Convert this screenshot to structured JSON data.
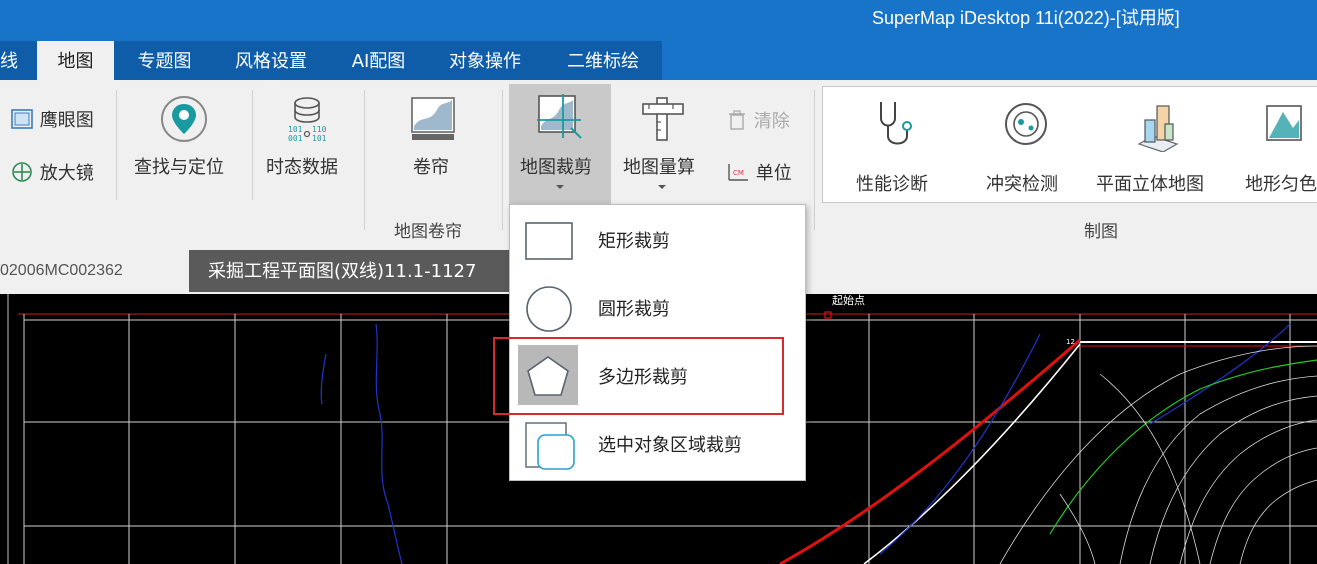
{
  "window": {
    "title": "SuperMap iDesktop 11i(2022)-[试用版]"
  },
  "tabs": [
    {
      "label": "线",
      "active": false
    },
    {
      "label": "地图",
      "active": true
    },
    {
      "label": "专题图",
      "active": false
    },
    {
      "label": "风格设置",
      "active": false
    },
    {
      "label": "AI配图",
      "active": false
    },
    {
      "label": "对象操作",
      "active": false
    },
    {
      "label": "二维标绘",
      "active": false
    }
  ],
  "ribbon": {
    "eagle_eye": "鹰眼图",
    "magnifier": "放大镜",
    "find_locate": "查找与定位",
    "temporal_data": "时态数据",
    "swipe": "卷帘",
    "map_swipe_group": "地图卷帘",
    "map_clip": "地图裁剪",
    "map_measure": "地图量算",
    "clear": "清除",
    "unit": "单位",
    "perf_diagnosis": "性能诊断",
    "conflict_detect": "冲突检测",
    "plane_3d_map": "平面立体地图",
    "terrain_shading": "地形匀色",
    "cartography_group": "制图"
  },
  "doc_tabs": {
    "inactive": "02006MC002362",
    "active": "采掘工程平面图(双线)11.1-1127"
  },
  "map": {
    "point_label": "起始点",
    "node_label": "12"
  },
  "clip_menu": {
    "items": [
      {
        "label": "矩形裁剪",
        "icon": "rectangle-icon"
      },
      {
        "label": "圆形裁剪",
        "icon": "circle-icon"
      },
      {
        "label": "多边形裁剪",
        "icon": "polygon-icon",
        "hovered": true
      },
      {
        "label": "选中对象区域裁剪",
        "icon": "selected-region-icon"
      }
    ]
  },
  "colors": {
    "titlebar": "#1874c8",
    "tab_strip": "#0f5ca8",
    "ribbon_bg": "#f0f0f0",
    "highlight_box": "#d92a2a",
    "map_bg": "#000000",
    "accent_teal": "#1a9aa0"
  }
}
